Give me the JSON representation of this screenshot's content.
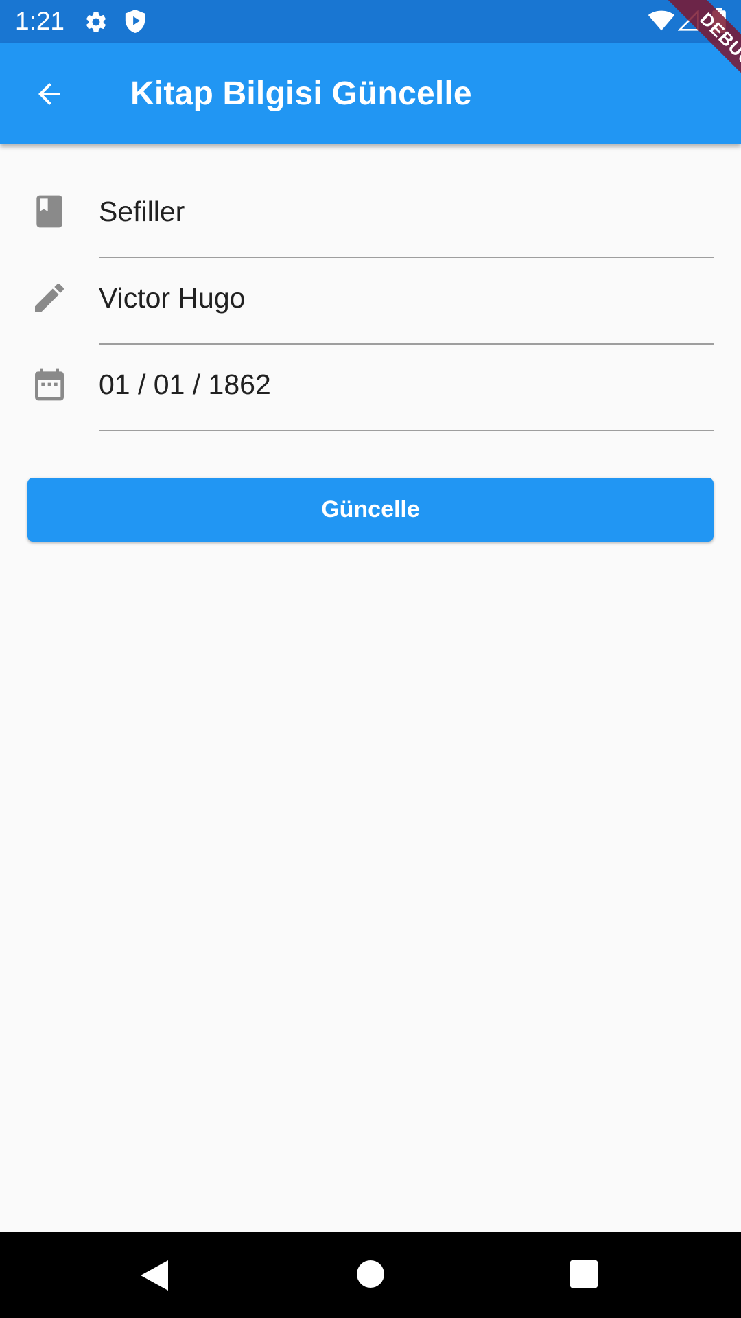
{
  "status_bar": {
    "time": "1:21",
    "icons": [
      "gear-icon",
      "shield-play-icon",
      "wifi-icon",
      "signal-icon",
      "battery-icon"
    ]
  },
  "app_bar": {
    "title": "Kitap Bilgisi Güncelle",
    "back_icon": "arrow-back-icon",
    "color": "#2196f3"
  },
  "debug_banner": {
    "label": "DEBUG"
  },
  "form": {
    "fields": [
      {
        "icon": "book-icon",
        "value": "Sefiller"
      },
      {
        "icon": "pencil-icon",
        "value": "Victor Hugo"
      },
      {
        "icon": "calendar-icon",
        "value": "01 / 01 / 1862"
      }
    ],
    "submit_label": "Güncelle"
  },
  "colors": {
    "status_bar": "#1976d2",
    "primary": "#2196f3",
    "background": "#fafafa",
    "icon_grey": "#8a8a8a"
  },
  "nav_bar": {
    "icons": [
      "nav-back-icon",
      "nav-home-icon",
      "nav-recents-icon"
    ]
  }
}
